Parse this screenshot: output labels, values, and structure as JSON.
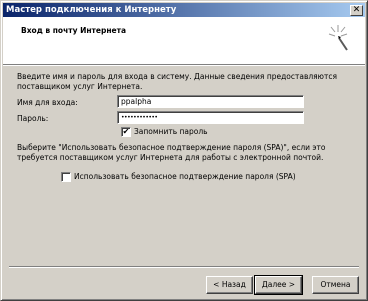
{
  "window": {
    "title": "Мастер подключения к Интернету",
    "close_glyph": "✕"
  },
  "header": {
    "title": "Вход в почту Интернета",
    "icon": "wizard-wand-icon"
  },
  "body": {
    "intro_line1": "Введите имя и пароль для входа в систему. Данные сведения предоставляются",
    "intro_line2": "поставщиком услуг Интернета.",
    "username_label": "Имя для входа:",
    "username_value": "ppalpha",
    "password_label": "Пароль:",
    "password_value": "••••••••••••",
    "remember_label": "Запомнить пароль",
    "remember_checked": "✔",
    "spa_text_line1": "Выберите \"Использовать безопасное подтверждение пароля (SPA)\", если это",
    "spa_text_line2": "требуется поставщиком услуг Интернета для работы с электронной почтой.",
    "spa_label": "Использовать безопасное подтверждение пароля (SPA)",
    "spa_checked": ""
  },
  "buttons": {
    "back": "< Назад",
    "next": "Далее >",
    "cancel": "Отмена"
  }
}
